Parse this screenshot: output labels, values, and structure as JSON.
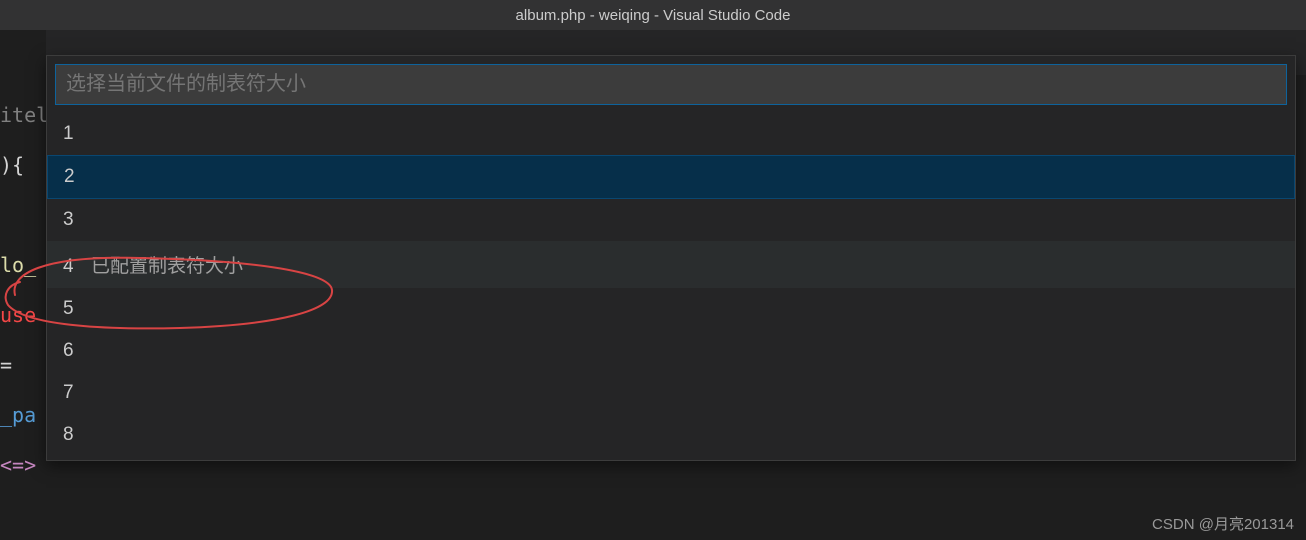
{
  "title_bar": {
    "title": "album.php - weiqing - Visual Studio Code"
  },
  "editor_fragments": [
    {
      "text": "itele",
      "class": "gray"
    },
    {
      "text": "){",
      "class": ""
    },
    {
      "text": "",
      "class": ""
    },
    {
      "text": "lo_",
      "class": "yellow"
    },
    {
      "text": "use",
      "class": "red"
    },
    {
      "text": " = ",
      "class": ""
    },
    {
      "text": "_pa",
      "class": "blue"
    },
    {
      "text": "<=>",
      "class": "pink"
    }
  ],
  "quick_pick": {
    "placeholder": "选择当前文件的制表符大小",
    "items": [
      {
        "num": "1",
        "desc": "",
        "state": ""
      },
      {
        "num": "2",
        "desc": "",
        "state": "selected"
      },
      {
        "num": "3",
        "desc": "",
        "state": ""
      },
      {
        "num": "4",
        "desc": "已配置制表符大小",
        "state": "hover"
      },
      {
        "num": "5",
        "desc": "",
        "state": ""
      },
      {
        "num": "6",
        "desc": "",
        "state": ""
      },
      {
        "num": "7",
        "desc": "",
        "state": ""
      },
      {
        "num": "8",
        "desc": "",
        "state": ""
      }
    ]
  },
  "watermark": "CSDN @月亮201314"
}
